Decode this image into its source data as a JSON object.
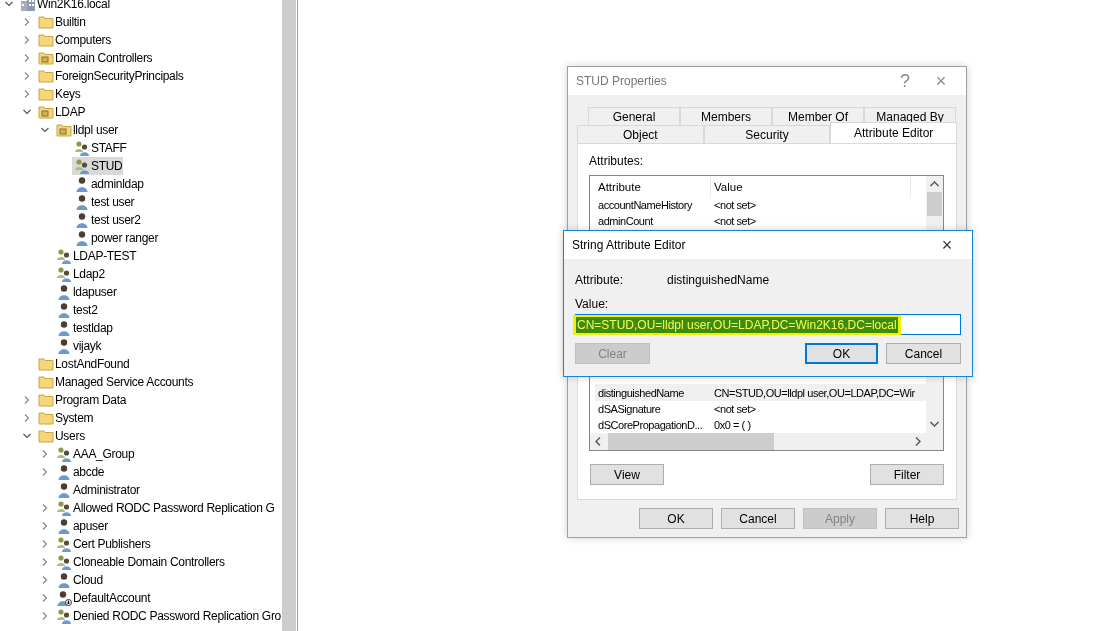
{
  "tree": [
    {
      "label": "Win2K16.local",
      "kind": "domain",
      "expanded": true,
      "selected": false,
      "children": [
        {
          "label": "Builtin",
          "kind": "folder",
          "expanded": false,
          "selected": false
        },
        {
          "label": "Computers",
          "kind": "folder",
          "expanded": false,
          "selected": false
        },
        {
          "label": "Domain Controllers",
          "kind": "ou",
          "expanded": false,
          "selected": false
        },
        {
          "label": "ForeignSecurityPrincipals",
          "kind": "folder",
          "expanded": false,
          "selected": false
        },
        {
          "label": "Keys",
          "kind": "folder",
          "expanded": false,
          "selected": false
        },
        {
          "label": "LDAP",
          "kind": "ou",
          "expanded": true,
          "selected": false,
          "children": [
            {
              "label": "lldpl user",
              "kind": "ou",
              "expanded": true,
              "selected": false,
              "children": [
                {
                  "label": "STAFF",
                  "kind": "group",
                  "selected": false
                },
                {
                  "label": "STUD",
                  "kind": "group",
                  "selected": true
                },
                {
                  "label": "adminldap",
                  "kind": "user",
                  "selected": false
                },
                {
                  "label": "test user",
                  "kind": "user",
                  "selected": false
                },
                {
                  "label": "test user2",
                  "kind": "user",
                  "selected": false
                },
                {
                  "label": "power ranger",
                  "kind": "user",
                  "selected": false
                }
              ]
            },
            {
              "label": "LDAP-TEST",
              "kind": "group",
              "selected": false
            },
            {
              "label": "Ldap2",
              "kind": "group",
              "selected": false
            },
            {
              "label": "ldapuser",
              "kind": "user",
              "selected": false
            },
            {
              "label": "test2",
              "kind": "user",
              "selected": false
            },
            {
              "label": "testldap",
              "kind": "user",
              "selected": false
            },
            {
              "label": "vijayk",
              "kind": "user",
              "selected": false
            }
          ]
        },
        {
          "label": "LostAndFound",
          "kind": "folder",
          "selected": false
        },
        {
          "label": "Managed Service Accounts",
          "kind": "folder",
          "selected": false
        },
        {
          "label": "Program Data",
          "kind": "folder",
          "expanded": false,
          "selected": false
        },
        {
          "label": "System",
          "kind": "folder",
          "expanded": false,
          "selected": false
        },
        {
          "label": "Users",
          "kind": "folder",
          "expanded": true,
          "selected": false,
          "children": [
            {
              "label": "AAA_Group",
              "kind": "group",
              "expanded": false,
              "selected": false
            },
            {
              "label": "abcde",
              "kind": "user",
              "expanded": false,
              "selected": false
            },
            {
              "label": "Administrator",
              "kind": "user",
              "selected": false
            },
            {
              "label": "Allowed RODC Password Replication G",
              "kind": "group",
              "expanded": false,
              "selected": false
            },
            {
              "label": "apuser",
              "kind": "user",
              "expanded": false,
              "selected": false
            },
            {
              "label": "Cert Publishers",
              "kind": "group",
              "expanded": false,
              "selected": false
            },
            {
              "label": "Cloneable Domain Controllers",
              "kind": "group",
              "expanded": false,
              "selected": false
            },
            {
              "label": "Cloud",
              "kind": "user",
              "expanded": false,
              "selected": false
            },
            {
              "label": "DefaultAccount",
              "kind": "disabled-user",
              "expanded": false,
              "selected": false
            },
            {
              "label": "Denied RODC Password Replication Gro",
              "kind": "group",
              "expanded": false,
              "selected": false
            }
          ]
        }
      ]
    }
  ],
  "properties_dialog": {
    "title": "STUD Properties",
    "help": "?",
    "close": "×",
    "tab_rows": [
      [
        {
          "label": "General",
          "selected": false
        },
        {
          "label": "Members",
          "selected": false
        },
        {
          "label": "Member Of",
          "selected": false
        },
        {
          "label": "Managed By",
          "selected": false
        }
      ],
      [
        {
          "label": "Object",
          "selected": false
        },
        {
          "label": "Security",
          "selected": false
        },
        {
          "label": "Attribute Editor",
          "selected": true
        }
      ]
    ],
    "attributes_label": "Attributes:",
    "columns": [
      "Attribute",
      "Value"
    ],
    "rows": [
      {
        "attribute": "accountNameHistory",
        "value": "<not set>",
        "selected": false
      },
      {
        "attribute": "adminCount",
        "value": "<not set>",
        "selected": false
      },
      {
        "attribute": "distinguishedName",
        "value": "CN=STUD,OU=lldpl user,OU=LDAP,DC=Wir",
        "selected": true
      },
      {
        "attribute": "dSASignature",
        "value": "<not set>",
        "selected": false
      },
      {
        "attribute": "dSCorePropagationD...",
        "value": "0x0 = (  )",
        "selected": false
      }
    ],
    "list_buttons": [
      {
        "label": "View",
        "disabled": false
      },
      {
        "label": "Filter",
        "disabled": false
      }
    ],
    "buttons": [
      {
        "label": "OK",
        "disabled": false
      },
      {
        "label": "Cancel",
        "disabled": false
      },
      {
        "label": "Apply",
        "disabled": true
      },
      {
        "label": "Help",
        "disabled": false
      }
    ]
  },
  "editor_dialog": {
    "title": "String Attribute Editor",
    "close": "×",
    "attribute_label": "Attribute:",
    "attribute": "distinguishedName",
    "value_label": "Value:",
    "value": "CN=STUD,OU=lldpl user,OU=LDAP,DC=Win2K16,DC=local",
    "value_selected": true,
    "highlighted": true,
    "buttons": [
      {
        "label": "Clear",
        "disabled": true,
        "default": false
      },
      {
        "label": "OK",
        "disabled": false,
        "default": true
      },
      {
        "label": "Cancel",
        "disabled": false,
        "default": false
      }
    ]
  }
}
